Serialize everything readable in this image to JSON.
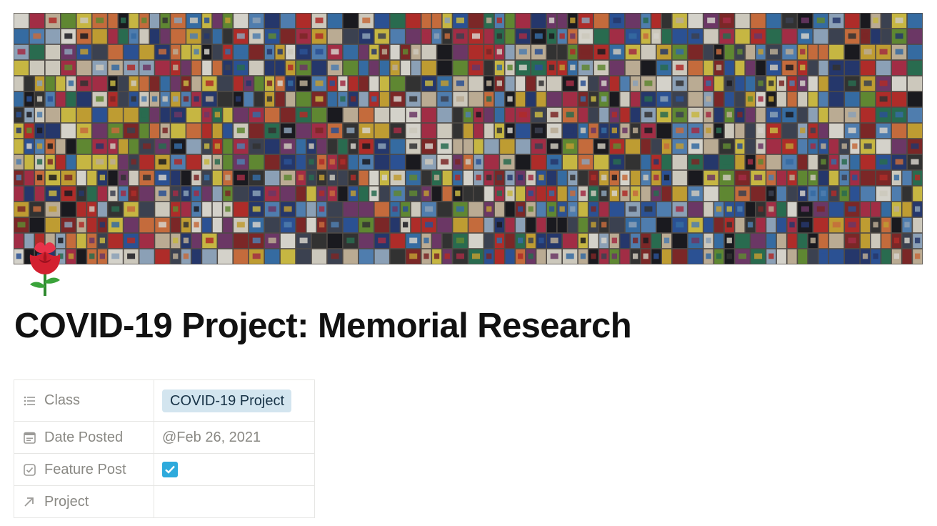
{
  "page": {
    "title": "COVID-19 Project: Memorial Research",
    "icon": "rose-icon",
    "cover": "memorial-quilt-mosaic-cover"
  },
  "properties": [
    {
      "name": "Class",
      "icon": "list-icon",
      "type": "select",
      "value": "COVID-19 Project"
    },
    {
      "name": "Date Posted",
      "icon": "calendar-icon",
      "type": "date",
      "value": "@Feb 26, 2021"
    },
    {
      "name": "Feature Post",
      "icon": "checkbox-icon",
      "type": "checkbox",
      "value": true
    },
    {
      "name": "Project",
      "icon": "relation-arrow-icon",
      "type": "relation",
      "value": ""
    }
  ],
  "colors": {
    "tag_bg": "#d3e5ef",
    "checkbox": "#2eaadc",
    "title": "#111111",
    "property_label": "#8a8984"
  }
}
